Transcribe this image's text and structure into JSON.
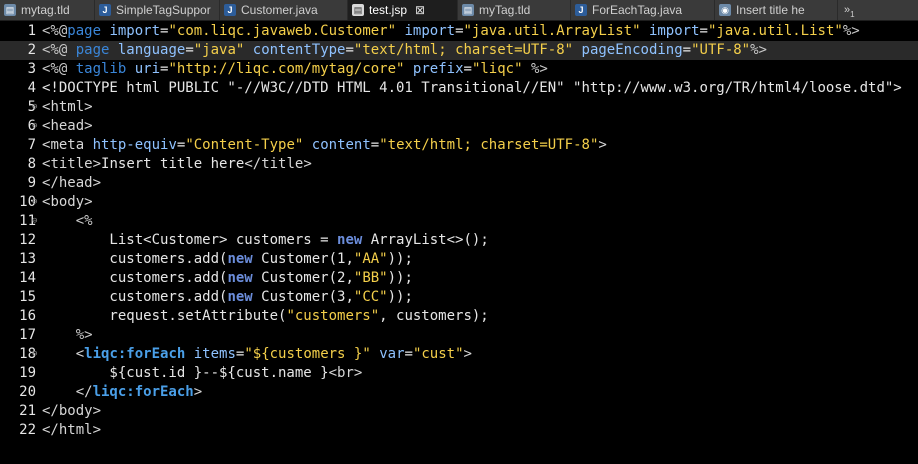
{
  "tabs": [
    {
      "label": "mytag.tld",
      "icon": "tld-file-icon",
      "active": false
    },
    {
      "label": "SimpleTagSuppor",
      "icon": "java-file-icon",
      "active": false
    },
    {
      "label": "Customer.java",
      "icon": "java-file-icon",
      "active": false
    },
    {
      "label": "test.jsp",
      "icon": "jsp-file-icon",
      "active": true
    },
    {
      "label": "myTag.tld",
      "icon": "tld-file-icon",
      "active": false
    },
    {
      "label": "ForEachTag.java",
      "icon": "java-file-icon",
      "active": false
    },
    {
      "label": "Insert title he",
      "icon": "web-browser-icon",
      "active": false
    }
  ],
  "overflow_count": "1",
  "current_line": 2,
  "lines": [
    {
      "num": "1",
      "fold": "",
      "tokens": [
        [
          "k-delim",
          "<%@"
        ],
        [
          "k-dir",
          "page"
        ],
        [
          "k-plain",
          " "
        ],
        [
          "k-attr",
          "import"
        ],
        [
          "k-plain",
          "="
        ],
        [
          "k-str",
          "\"com.liqc.javaweb.Customer\""
        ],
        [
          "k-plain",
          " "
        ],
        [
          "k-attr",
          "import"
        ],
        [
          "k-plain",
          "="
        ],
        [
          "k-str",
          "\"java.util.ArrayList\""
        ],
        [
          "k-plain",
          " "
        ],
        [
          "k-attr",
          "import"
        ],
        [
          "k-plain",
          "="
        ],
        [
          "k-str",
          "\"java.util.List\""
        ],
        [
          "k-delim",
          "%>"
        ]
      ]
    },
    {
      "num": "2",
      "fold": "",
      "tokens": [
        [
          "k-delim",
          "<%@ "
        ],
        [
          "k-dir",
          "page"
        ],
        [
          "k-plain",
          " "
        ],
        [
          "k-attr",
          "language"
        ],
        [
          "k-plain",
          "="
        ],
        [
          "k-str",
          "\"java\""
        ],
        [
          "k-plain",
          " "
        ],
        [
          "k-attr",
          "contentType"
        ],
        [
          "k-plain",
          "="
        ],
        [
          "k-str",
          "\"text/html; charset=UTF-8\""
        ],
        [
          "k-plain",
          " "
        ],
        [
          "k-attr",
          "pageEncoding"
        ],
        [
          "k-plain",
          "="
        ],
        [
          "k-str",
          "\"UTF-8\""
        ],
        [
          "k-delim",
          "%>"
        ]
      ]
    },
    {
      "num": "3",
      "fold": "",
      "tokens": [
        [
          "k-delim",
          "<%@ "
        ],
        [
          "k-dir",
          "taglib"
        ],
        [
          "k-plain",
          " "
        ],
        [
          "k-attr",
          "uri"
        ],
        [
          "k-plain",
          "="
        ],
        [
          "k-str",
          "\"http://liqc.com/mytag/core\""
        ],
        [
          "k-plain",
          " "
        ],
        [
          "k-attr",
          "prefix"
        ],
        [
          "k-plain",
          "="
        ],
        [
          "k-str",
          "\"liqc\""
        ],
        [
          "k-plain",
          " "
        ],
        [
          "k-delim",
          "%>"
        ]
      ]
    },
    {
      "num": "4",
      "fold": "",
      "tokens": [
        [
          "k-plain",
          "<!DOCTYPE html PUBLIC \"-//W3C//DTD HTML 4.01 Transitional//EN\" \"http://www.w3.org/TR/html4/loose.dtd\">"
        ]
      ]
    },
    {
      "num": "5",
      "fold": "⊖",
      "tokens": [
        [
          "k-tag",
          "<"
        ],
        [
          "k-tagname",
          "html"
        ],
        [
          "k-tag",
          ">"
        ]
      ]
    },
    {
      "num": "6",
      "fold": "⊖",
      "tokens": [
        [
          "k-tag",
          "<"
        ],
        [
          "k-tagname",
          "head"
        ],
        [
          "k-tag",
          ">"
        ]
      ]
    },
    {
      "num": "7",
      "fold": "",
      "tokens": [
        [
          "k-tag",
          "<"
        ],
        [
          "k-tagname",
          "meta"
        ],
        [
          "k-plain",
          " "
        ],
        [
          "k-attr",
          "http-equiv"
        ],
        [
          "k-plain",
          "="
        ],
        [
          "k-str",
          "\"Content-Type\""
        ],
        [
          "k-plain",
          " "
        ],
        [
          "k-attr",
          "content"
        ],
        [
          "k-plain",
          "="
        ],
        [
          "k-str",
          "\"text/html; charset=UTF-8\""
        ],
        [
          "k-tag",
          ">"
        ]
      ]
    },
    {
      "num": "8",
      "fold": "",
      "tokens": [
        [
          "k-tag",
          "<"
        ],
        [
          "k-tagname",
          "title"
        ],
        [
          "k-tag",
          ">"
        ],
        [
          "k-plain",
          "Insert title here"
        ],
        [
          "k-tag",
          "</"
        ],
        [
          "k-tagname",
          "title"
        ],
        [
          "k-tag",
          ">"
        ]
      ]
    },
    {
      "num": "9",
      "fold": "",
      "tokens": [
        [
          "k-tag",
          "</"
        ],
        [
          "k-tagname",
          "head"
        ],
        [
          "k-tag",
          ">"
        ]
      ]
    },
    {
      "num": "10",
      "fold": "⊖",
      "tokens": [
        [
          "k-tag",
          "<"
        ],
        [
          "k-tagname",
          "body"
        ],
        [
          "k-tag",
          ">"
        ]
      ]
    },
    {
      "num": "11",
      "fold": "⊖",
      "tokens": [
        [
          "k-plain",
          "    "
        ],
        [
          "k-delim",
          "<%"
        ]
      ]
    },
    {
      "num": "12",
      "fold": "",
      "tokens": [
        [
          "k-plain",
          "        List<Customer> customers = "
        ],
        [
          "k-kw",
          "new"
        ],
        [
          "k-plain",
          " ArrayList<>();"
        ]
      ]
    },
    {
      "num": "13",
      "fold": "",
      "tokens": [
        [
          "k-plain",
          "        customers.add("
        ],
        [
          "k-kw",
          "new"
        ],
        [
          "k-plain",
          " Customer(1,"
        ],
        [
          "k-str",
          "\"AA\""
        ],
        [
          "k-plain",
          "));"
        ]
      ]
    },
    {
      "num": "14",
      "fold": "",
      "tokens": [
        [
          "k-plain",
          "        customers.add("
        ],
        [
          "k-kw",
          "new"
        ],
        [
          "k-plain",
          " Customer(2,"
        ],
        [
          "k-str",
          "\"BB\""
        ],
        [
          "k-plain",
          "));"
        ]
      ]
    },
    {
      "num": "15",
      "fold": "",
      "tokens": [
        [
          "k-plain",
          "        customers.add("
        ],
        [
          "k-kw",
          "new"
        ],
        [
          "k-plain",
          " Customer(3,"
        ],
        [
          "k-str",
          "\"CC\""
        ],
        [
          "k-plain",
          "));"
        ]
      ]
    },
    {
      "num": "16",
      "fold": "",
      "tokens": [
        [
          "k-plain",
          "        request.setAttribute("
        ],
        [
          "k-str",
          "\"customers\""
        ],
        [
          "k-plain",
          ", customers);"
        ]
      ]
    },
    {
      "num": "17",
      "fold": "",
      "tokens": [
        [
          "k-plain",
          "    "
        ],
        [
          "k-delim",
          "%>"
        ]
      ]
    },
    {
      "num": "18",
      "fold": "⊖",
      "tokens": [
        [
          "k-plain",
          "    "
        ],
        [
          "k-tag",
          "<"
        ],
        [
          "k-lib",
          "liqc:forEach"
        ],
        [
          "k-plain",
          " "
        ],
        [
          "k-attr",
          "items"
        ],
        [
          "k-plain",
          "="
        ],
        [
          "k-str",
          "\"${customers }\""
        ],
        [
          "k-plain",
          " "
        ],
        [
          "k-attr",
          "var"
        ],
        [
          "k-plain",
          "="
        ],
        [
          "k-str",
          "\"cust\""
        ],
        [
          "k-tag",
          ">"
        ]
      ]
    },
    {
      "num": "19",
      "fold": "",
      "tokens": [
        [
          "k-plain",
          "        ${cust.id }--${cust.name }"
        ],
        [
          "k-tag",
          "<"
        ],
        [
          "k-tagname",
          "br"
        ],
        [
          "k-tag",
          ">"
        ]
      ]
    },
    {
      "num": "20",
      "fold": "",
      "tokens": [
        [
          "k-plain",
          "    "
        ],
        [
          "k-tag",
          "</"
        ],
        [
          "k-lib",
          "liqc:forEach"
        ],
        [
          "k-tag",
          ">"
        ]
      ]
    },
    {
      "num": "21",
      "fold": "",
      "tokens": [
        [
          "k-tag",
          "</"
        ],
        [
          "k-tagname",
          "body"
        ],
        [
          "k-tag",
          ">"
        ]
      ]
    },
    {
      "num": "22",
      "fold": "",
      "tokens": [
        [
          "k-tag",
          "</"
        ],
        [
          "k-tagname",
          "html"
        ],
        [
          "k-tag",
          ">"
        ]
      ]
    }
  ]
}
